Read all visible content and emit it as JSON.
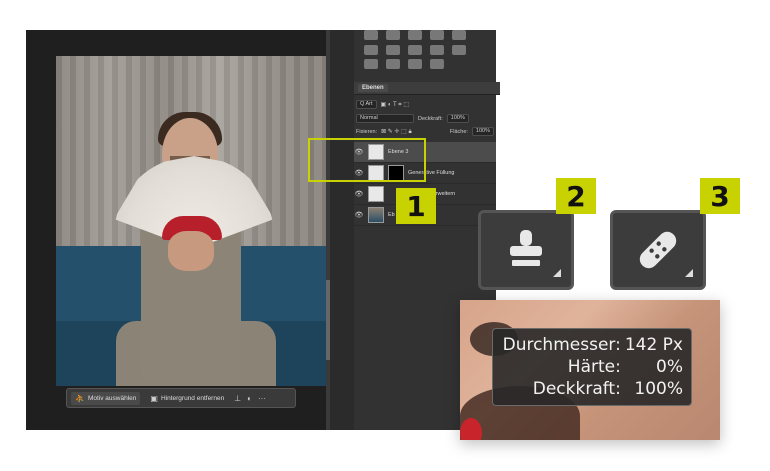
{
  "photoshop": {
    "context_bar": {
      "select_subject_label": "Motiv auswählen",
      "remove_background_label": "Hintergrund entfernen",
      "more_label": "···"
    },
    "layers_panel": {
      "tab_label": "Ebenen",
      "filter_label": "Q Art",
      "blend_mode": "Normal",
      "opacity_label": "Deckkraft:",
      "opacity_value": "100%",
      "fix_label": "Fixieren:",
      "fill_label": "Fläche:",
      "fill_value": "100%",
      "layers": [
        {
          "name": "Ebene 3",
          "active": true
        },
        {
          "name": "Generative Füllung",
          "active": false
        },
        {
          "name": "Erweitern",
          "active": false
        },
        {
          "name": "Eb",
          "active": false
        }
      ]
    }
  },
  "callouts": {
    "badge_1": "1",
    "badge_2": "2",
    "badge_3": "3",
    "highlight_color": "#c8d200"
  },
  "tools": {
    "tile_2_icon": "clone-stamp-icon",
    "tile_3_icon": "healing-brush-icon"
  },
  "brush_tooltip": {
    "diameter_label": "Durchmesser:",
    "diameter_value": "142 Px",
    "hardness_label": "Härte:",
    "hardness_value": "0%",
    "opacity_label": "Deckkraft:",
    "opacity_value": "100%"
  }
}
